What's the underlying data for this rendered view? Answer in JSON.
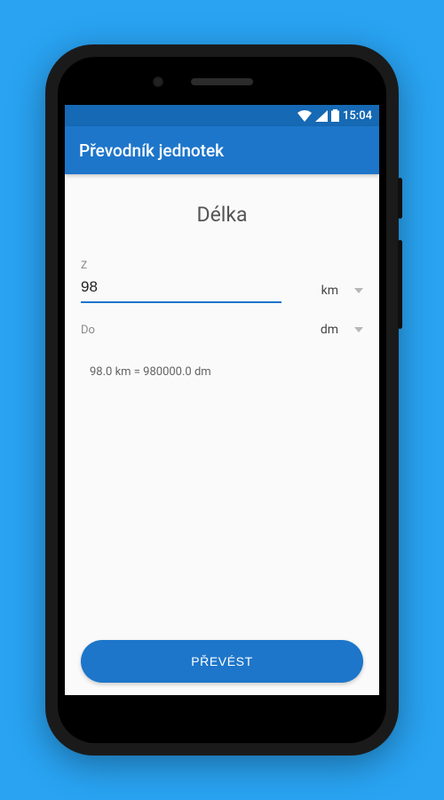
{
  "statusbar": {
    "time": "15:04"
  },
  "appbar": {
    "title": "Převodník jednotek"
  },
  "page": {
    "title": "Délka",
    "from_label": "Z",
    "from_value": "98",
    "from_unit": "km",
    "to_label": "Do",
    "to_unit": "dm",
    "result": "98.0 km = 980000.0 dm",
    "convert_label": "PŘEVÉST"
  }
}
